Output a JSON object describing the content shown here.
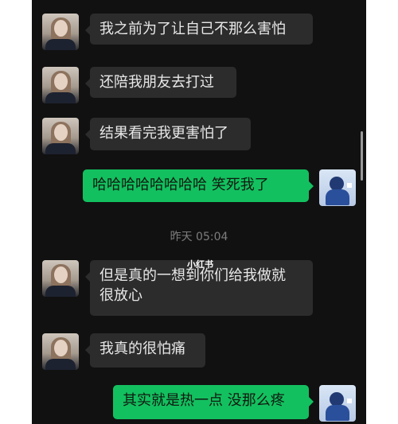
{
  "messages": [
    {
      "sender": "other",
      "text": "我之前为了让自己不那么害怕"
    },
    {
      "sender": "other",
      "text": "还陪我朋友去打过"
    },
    {
      "sender": "other",
      "text": "结果看完我更害怕了"
    },
    {
      "sender": "me",
      "text": "哈哈哈哈哈哈哈哈 笑死我了"
    },
    {
      "sender": "other",
      "text": "但是真的一想到你们给我做就\n很放心"
    },
    {
      "sender": "other",
      "text": "我真的很怕痛"
    },
    {
      "sender": "me",
      "text": "其实就是热一点 没那么疼"
    }
  ],
  "timestamp": "昨天 05:04",
  "watermark": "小红书",
  "colors": {
    "background": "#111111",
    "incoming_bubble": "#2c2c2c",
    "outgoing_bubble": "#13c05f"
  }
}
